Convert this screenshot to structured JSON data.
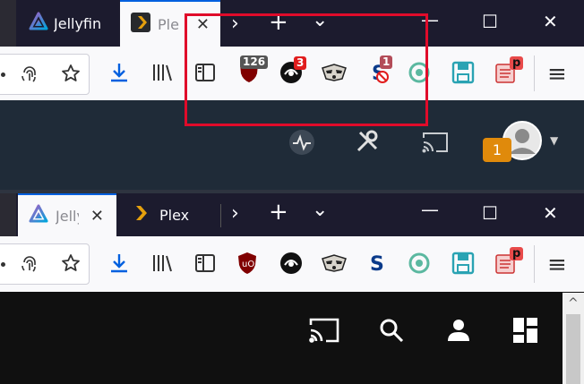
{
  "top_window": {
    "tabs": [
      {
        "title": "Jellyfin",
        "active": false
      },
      {
        "title": "Plex",
        "active": true
      }
    ],
    "badges": {
      "ublock_count": "126",
      "ext2_count": "3",
      "ext4_count": "1",
      "pdf_letter": "p"
    },
    "notification_count": "1"
  },
  "bottom_window": {
    "tabs": [
      {
        "title": "Jellyfin",
        "active": true
      },
      {
        "title": "Plex",
        "active": false
      }
    ],
    "badges": {
      "pdf_letter": "p"
    }
  },
  "icons": {
    "new_tab": "+",
    "tab_list": "⌄",
    "minimize": "—",
    "maximize": "☐",
    "close": "✕",
    "menu": "≡",
    "scroll_up": "^"
  },
  "colors": {
    "tabbar_bg": "#1c1b2e",
    "toolbar_bg": "#f9f9fb",
    "accent_blue": "#0060df",
    "highlight_red": "#e00b2a",
    "badge_orange": "#e08a0b",
    "badge_red": "#e11d1d"
  }
}
